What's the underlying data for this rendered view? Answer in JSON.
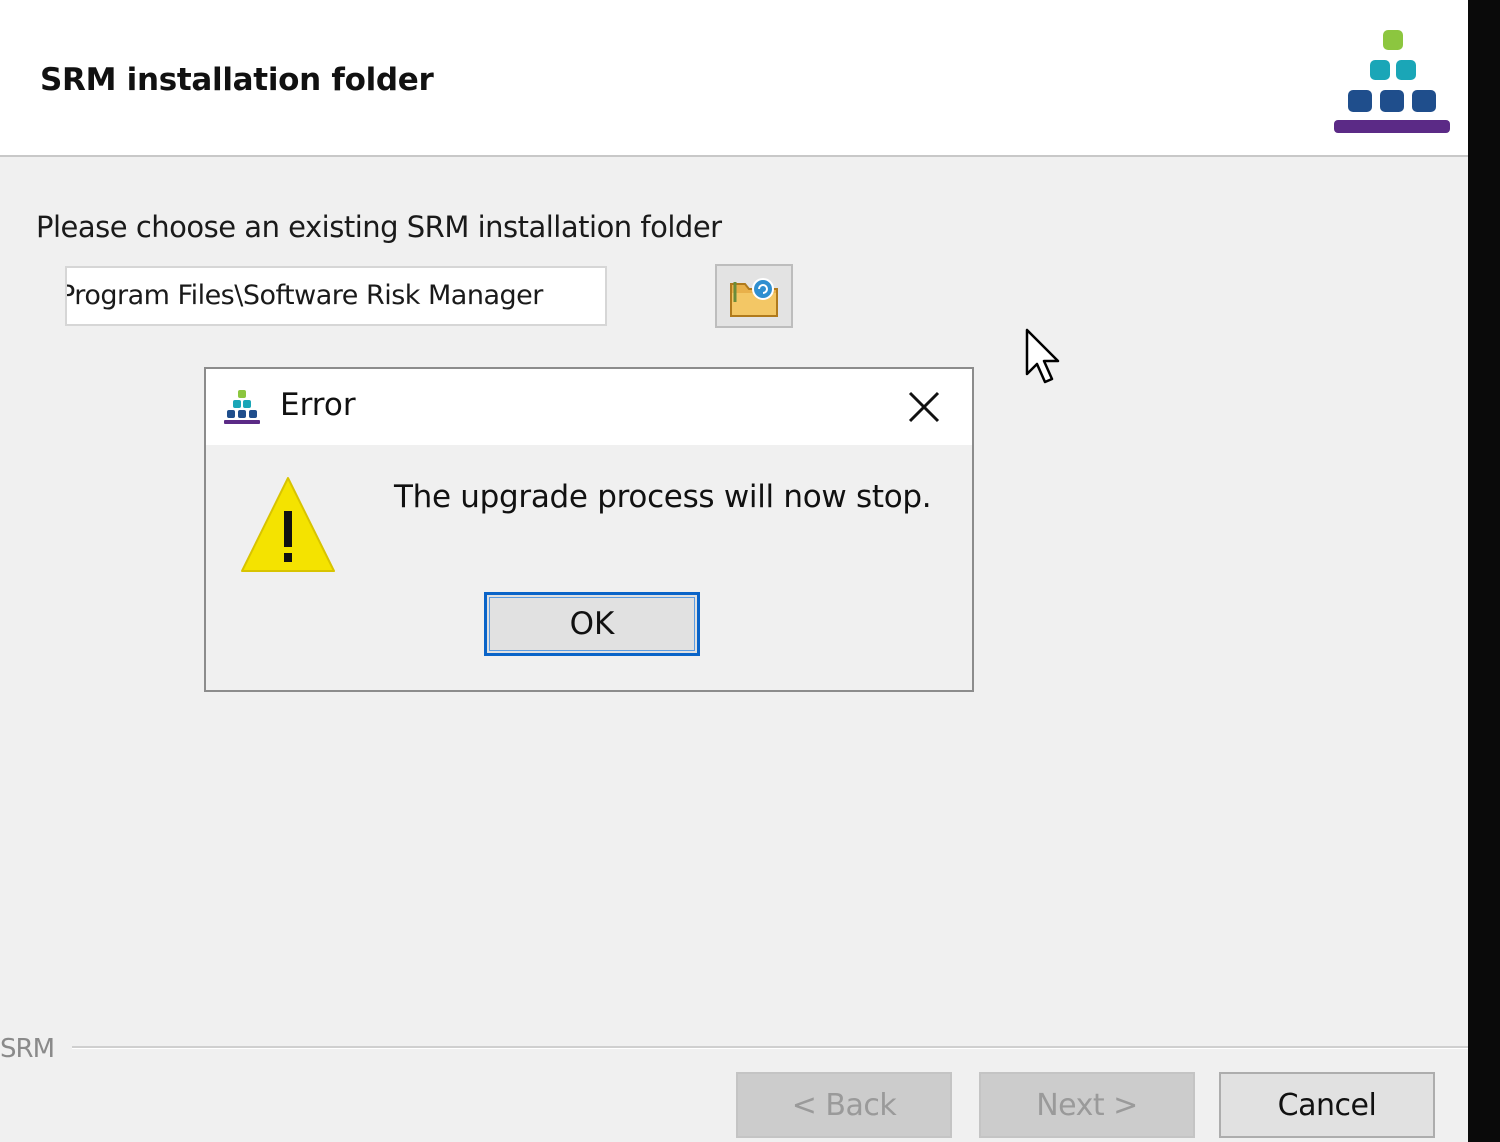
{
  "header": {
    "title": "SRM installation folder"
  },
  "form": {
    "prompt": "Please choose an existing SRM installation folder",
    "path_value": "Program Files\\Software Risk Manager"
  },
  "dialog": {
    "title": "Error",
    "message": "The upgrade process will now stop.",
    "ok_label": "OK"
  },
  "footer": {
    "label": "SRM",
    "back_label": "< Back",
    "next_label": "Next >",
    "cancel_label": "Cancel"
  },
  "icons": {
    "logo": "pyramid-logo-icon",
    "browse": "folder-browse-icon",
    "dialog": "pyramid-logo-icon",
    "close": "close-icon",
    "warning": "warning-icon",
    "cursor": "mouse-cursor-icon"
  },
  "colors": {
    "accent_focus": "#0a64c8",
    "warning_yellow": "#f4e300",
    "logo_green": "#8cc63f",
    "logo_teal": "#1aa6b7",
    "logo_blue": "#1f4e8c",
    "logo_purple": "#5b2a86"
  }
}
